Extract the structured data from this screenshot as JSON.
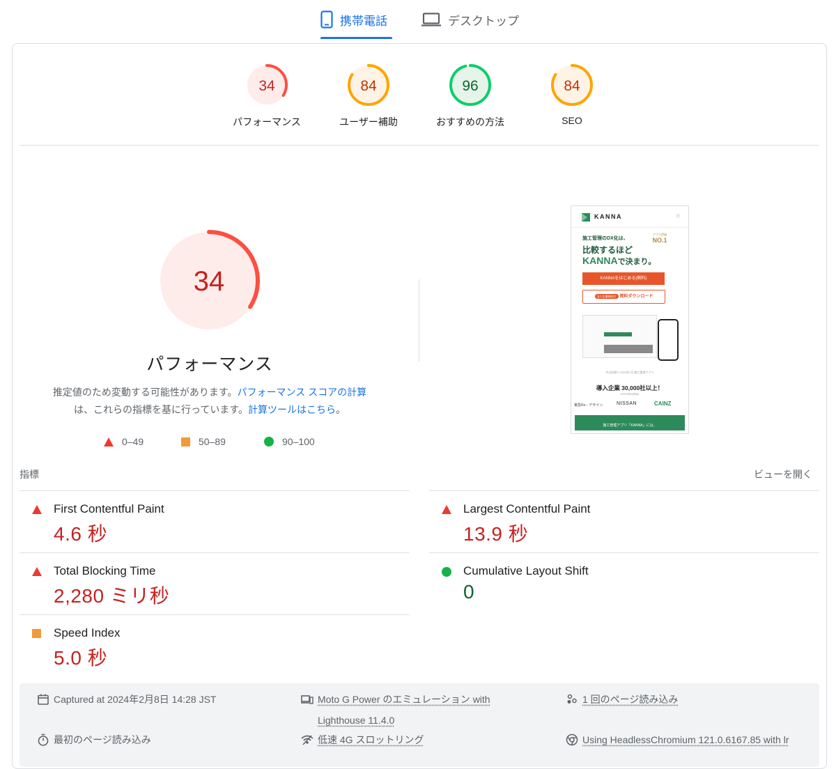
{
  "tabs": [
    {
      "label": "携帯電話",
      "icon": "mobile-phone-icon",
      "active": true
    },
    {
      "label": "デスクトップ",
      "icon": "laptop-icon",
      "active": false
    }
  ],
  "colors": {
    "fail": "#ff4e42",
    "fail_bg": "#fdecea",
    "average": "#ffa400",
    "average_bg": "#fff3e6",
    "pass": "#0cce6b",
    "pass_bg": "#e6f4ea",
    "link": "#1a73e8"
  },
  "gauges": [
    {
      "score": "34",
      "label": "パフォーマンス",
      "rating": "fail",
      "fraction": 0.34
    },
    {
      "score": "84",
      "label": "ユーザー補助",
      "rating": "average",
      "fraction": 0.84
    },
    {
      "score": "96",
      "label": "おすすめの方法",
      "rating": "pass",
      "fraction": 0.96
    },
    {
      "score": "84",
      "label": "SEO",
      "rating": "average",
      "fraction": 0.84
    }
  ],
  "performance": {
    "score": "34",
    "fraction": 0.34,
    "title": "パフォーマンス",
    "desc_1": "推定値のため変動する可能性があります。",
    "link_1": "パフォーマンス スコアの計算",
    "desc_2": "は、これらの指標を基に行っています。",
    "link_2": "計算ツールはこちら",
    "desc_3": "。"
  },
  "legend": {
    "fail": "0–49",
    "average": "50–89",
    "pass": "90–100"
  },
  "screenshot": {
    "brand": "KANNA",
    "line1": "施工管理のDX化は、",
    "line2": "比較するほど",
    "line3_a": "KANNA",
    "line3_b": "で決まり。",
    "badge_small": "アプリ評価",
    "badge": "NO.1",
    "cta_primary": "KANNAをはじめる(無料)",
    "cta_tag": "法人企業様向け",
    "cta_secondary": "資料ダウンロード",
    "note": "※当社調べ 2023年7月 施工管理アプリ",
    "headline": "導入企業 30,000社以上！",
    "subnote": "※2023年6月時点",
    "logo1": "東急Re・デザイン",
    "logo2": "NISSAN",
    "logo3": "CAINZ",
    "banner": "施工管理アプリ「KANNA」には、"
  },
  "metrics_header": {
    "title": "指標",
    "toggle": "ビューを開く"
  },
  "metrics": [
    {
      "name": "First Contentful Paint",
      "value": "4.6 秒",
      "rating": "fail"
    },
    {
      "name": "Largest Contentful Paint",
      "value": "13.9 秒",
      "rating": "fail"
    },
    {
      "name": "Total Blocking Time",
      "value": "2,280 ミリ秒",
      "rating": "fail"
    },
    {
      "name": "Cumulative Layout Shift",
      "value": "0",
      "rating": "pass"
    },
    {
      "name": "Speed Index",
      "value": "5.0 秒",
      "rating": "average"
    }
  ],
  "footer": {
    "captured": "Captured at 2024年2月8日 14:28 JST",
    "device": "Moto G Power のエミュレーション with",
    "device_2": "Lighthouse 11.4.0",
    "loads": "1 回のページ読み込み",
    "initial": "最初のページ読み込み",
    "throttle": "低速 4G スロットリング",
    "browser": "Using HeadlessChromium 121.0.6167.85 with lr"
  }
}
